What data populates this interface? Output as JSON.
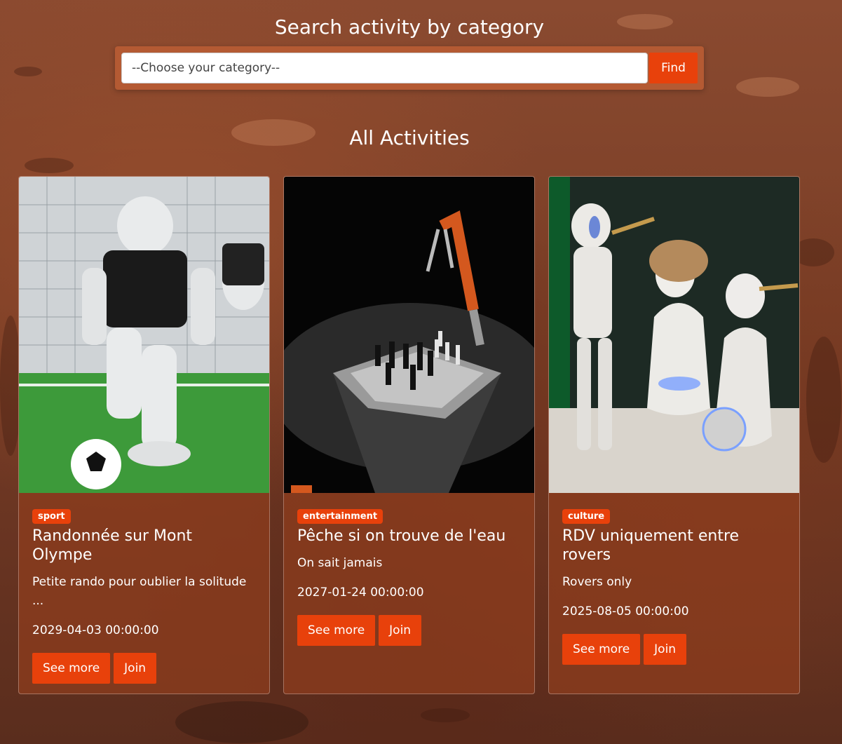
{
  "search": {
    "title": "Search activity by category",
    "placeholder": "--Choose your category--",
    "find_label": "Find"
  },
  "section_title": "All Activities",
  "activities": [
    {
      "category": "sport",
      "title": "Randonnée sur Mont Olympe",
      "description": "Petite rando pour oublier la solitude ...",
      "date": "2029-04-03 00:00:00",
      "see_more_label": "See more",
      "join_label": "Join",
      "image_icon": "robot-soccer-image"
    },
    {
      "category": "entertainment",
      "title": "Pêche si on trouve de l'eau",
      "description": "On sait jamais",
      "date": "2027-01-24 00:00:00",
      "see_more_label": "See more",
      "join_label": "Join",
      "image_icon": "robot-chess-image"
    },
    {
      "category": "culture",
      "title": "RDV uniquement entre rovers",
      "description": "Rovers only",
      "date": "2025-08-05 00:00:00",
      "see_more_label": "See more",
      "join_label": "Join",
      "image_icon": "robot-band-image"
    }
  ],
  "colors": {
    "accent": "#e8410b",
    "card_bg": "#8c3c1e",
    "search_bar_bg": "#b45a33"
  }
}
